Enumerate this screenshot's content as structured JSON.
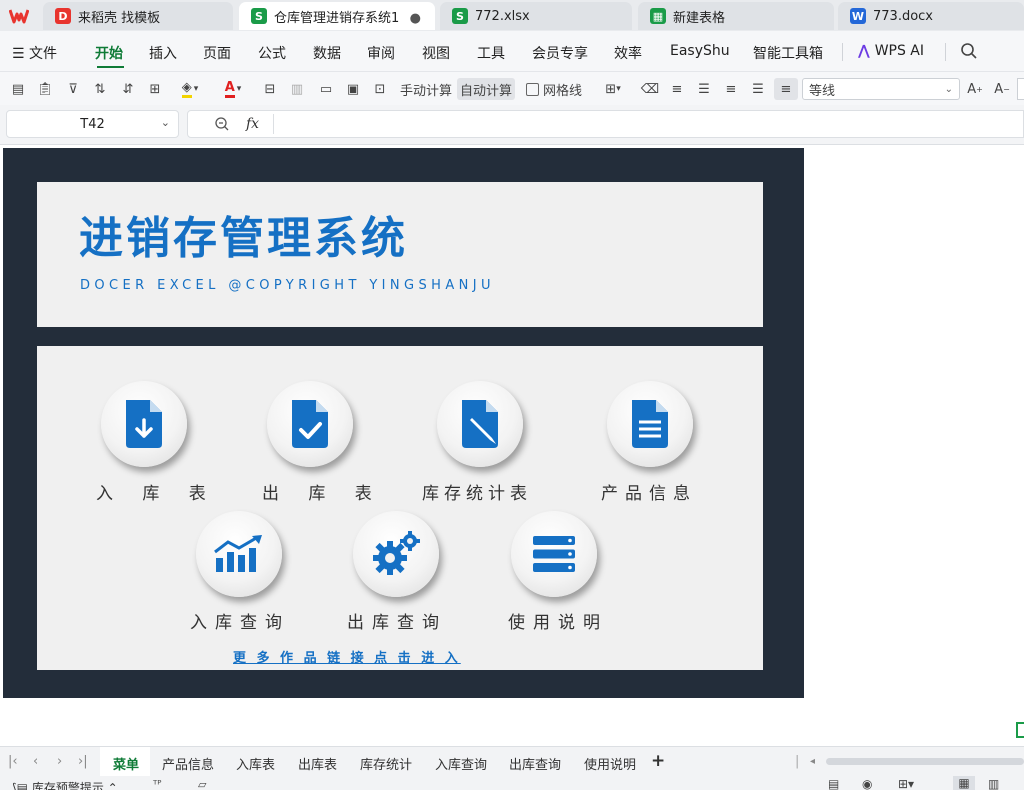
{
  "tabs": {
    "docer": "来稻壳 找模板",
    "active_doc": "仓库管理进销存系统1",
    "xlsx": "772.xlsx",
    "new_sheet": "新建表格",
    "docx": "773.docx"
  },
  "menu": {
    "file": "文件",
    "items": [
      "开始",
      "插入",
      "页面",
      "公式",
      "数据",
      "审阅",
      "视图",
      "工具",
      "会员专享",
      "效率",
      "EasyShu",
      "智能工具箱"
    ],
    "wps_ai": "WPS AI"
  },
  "toolbar": {
    "manual_calc": "手动计算",
    "auto_calc": "自动计算",
    "gridlines": "网格线",
    "font_name": "等线"
  },
  "formula_bar": {
    "cell_ref": "T42",
    "fx": "fx",
    "value": ""
  },
  "dashboard": {
    "title": "进销存管理系统",
    "subtitle": "DOCER EXCEL @COPYRIGHT YINGSHANJU",
    "buttons": [
      "入 库 表",
      "出 库 表",
      "库存统计表",
      "产品信息",
      "入库查询",
      "出库查询",
      "使用说明"
    ],
    "more_link": "更 多 作 品 链 接 点 击 进 入"
  },
  "sheet_tabs": [
    "菜单",
    "产品信息",
    "入库表",
    "出库表",
    "库存统计",
    "入库查询",
    "出库查询",
    "使用说明"
  ],
  "status": {
    "warning": "库存预警提示"
  },
  "colors": {
    "accent_green": "#0f7b37",
    "icon_blue": "#1570c4",
    "dashboard_bg": "#232d3a",
    "card_bg": "#f0f0f0"
  }
}
